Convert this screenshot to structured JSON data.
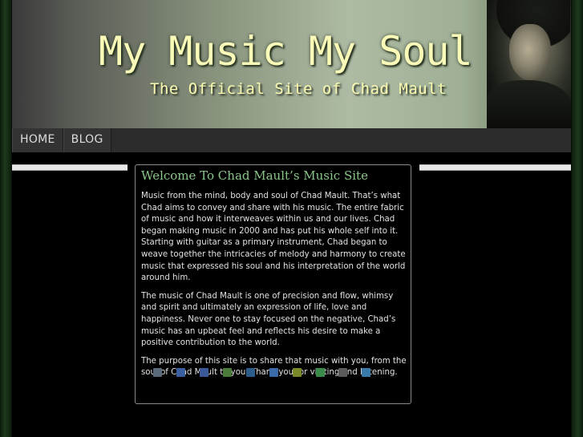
{
  "header": {
    "title": "My Music My Soul",
    "subtitle": "The Official Site of Chad Mault"
  },
  "nav": {
    "items": [
      {
        "label": "HOME"
      },
      {
        "label": "BLOG"
      }
    ]
  },
  "content": {
    "title": "Welcome To Chad Mault’s Music Site",
    "paragraphs": [
      "Music from the mind, body and soul of Chad Mault. That’s what Chad aims to convey and share with his music.  The entire fabric of music and how it interweaves within us and our lives.  Chad began making music in 2000 and has put his whole self into it.  Starting with guitar as a primary instrument, Chad began to weave together the intricacies of melody and harmony to create music that expressed his soul and his interpretation of the world around him.",
      "The music of Chad Mault is one of precision and flow, whimsy and spirit and ultimately an expression of life, love and happiness.  Never one to stay focused on the negative, Chad’s music has an upbeat feel and reflects his desire to make a positive contribution to the world.",
      "The purpose of this site is to share that music with you, from the soul of Chad Mault to you.  Thank you for visiting and listening."
    ]
  },
  "share_icons": [
    {
      "icon": "social-share-icon",
      "color": "#5a6a7a"
    },
    {
      "icon": "delicious-icon",
      "color": "#3a5fa0"
    },
    {
      "icon": "facebook-icon",
      "color": "#3b5998"
    },
    {
      "icon": "google-icon",
      "color": "#4a7a3a"
    },
    {
      "icon": "linkedin-icon",
      "color": "#2d5d8a"
    },
    {
      "icon": "myspace-icon",
      "color": "#3a6aa8"
    },
    {
      "icon": "newsvine-icon",
      "color": "#7a8a2a"
    },
    {
      "icon": "stumbleupon-icon",
      "color": "#3a8a4a"
    },
    {
      "icon": "technorati-icon",
      "color": "#5a5a5a"
    },
    {
      "icon": "twitter-icon",
      "color": "#3a7aa8"
    }
  ]
}
